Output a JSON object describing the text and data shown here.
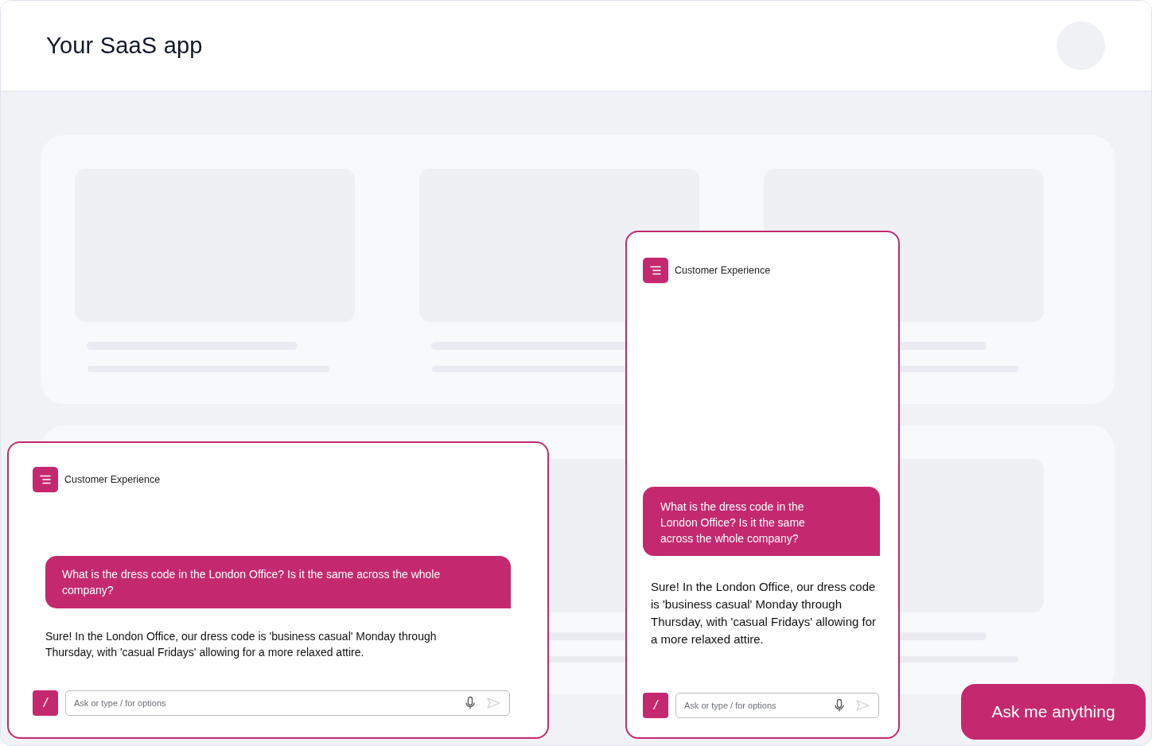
{
  "header": {
    "title": "Your SaaS app"
  },
  "chats": [
    {
      "title": "Customer Experience",
      "question": "What is the dress code in the London Office? Is it the same across the whole company?",
      "answer": "Sure! In the London Office, our dress code is 'business casual' Monday through Thursday, with 'casual Fridays' allowing for a more relaxed attire.",
      "slash_key": "/",
      "input": {
        "placeholder": "Ask or type / for options"
      }
    },
    {
      "title": "Customer Experience",
      "question": "What is the dress code in the London Office? Is it the same across the whole company?",
      "answer": "Sure! In the London Office, our dress code is 'business casual' Monday through Thursday, with 'casual Fridays' allowing for a more relaxed attire.",
      "slash_key": "/",
      "input": {
        "placeholder": "Ask or type / for options"
      }
    }
  ],
  "ask_button": {
    "label": "Ask me anything"
  }
}
